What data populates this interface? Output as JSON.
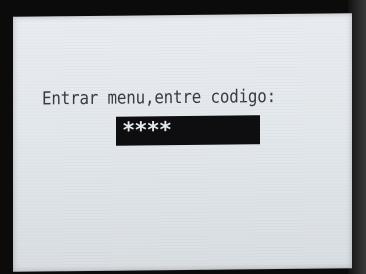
{
  "screen": {
    "prompt": "Entrar menu,entre codigo:",
    "code_value": "****"
  },
  "colors": {
    "screen_background": "#e3e8ec",
    "text": "#3a3a44",
    "field_background": "#0e0e10",
    "field_text": "#e6eaee",
    "bezel": "#0b0b0b"
  }
}
